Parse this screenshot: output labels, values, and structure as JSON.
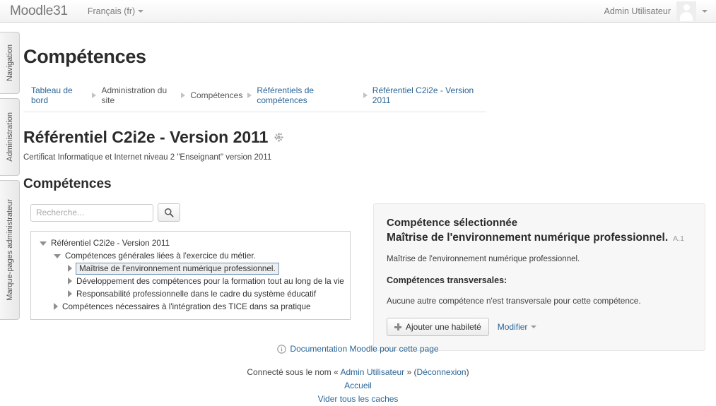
{
  "navbar": {
    "brand": "Moodle31",
    "language": "Français (fr)",
    "user_name": "Admin Utilisateur",
    "avatar_icon": "user-avatar-icon",
    "caret_icon": "chevron-down-icon"
  },
  "dock": {
    "tabs": [
      {
        "label": "Navigation"
      },
      {
        "label": "Administration"
      },
      {
        "label": "Marque-pages administrateur"
      }
    ]
  },
  "page": {
    "title": "Compétences"
  },
  "breadcrumb": {
    "items": [
      {
        "label": "Tableau de bord",
        "link": true
      },
      {
        "label": "Administration du site",
        "link": false
      },
      {
        "label": "Compétences",
        "link": false
      },
      {
        "label": "Référentiels de compétences",
        "link": true
      },
      {
        "label": "Référentiel C2i2e - Version 2011",
        "link": true
      }
    ]
  },
  "framework": {
    "title": "Référentiel C2i2e - Version 2011",
    "settings_icon": "gear-icon",
    "description": "Certificat Informatique et Internet niveau 2 \"Enseignant\" version 2011",
    "section_title": "Compétences"
  },
  "search": {
    "placeholder": "Recherche...",
    "value": "",
    "button_icon": "search-icon"
  },
  "tree": {
    "nodes": [
      {
        "label": "Référentiel C2i2e - Version 2011",
        "level": 0,
        "state": "expanded",
        "selected": false
      },
      {
        "label": "Compétences générales liées à l'exercice du métier.",
        "level": 1,
        "state": "expanded",
        "selected": false
      },
      {
        "label": "Maîtrise de l'environnement numérique professionnel.",
        "level": 2,
        "state": "collapsed",
        "selected": true
      },
      {
        "label": "Développement des compétences pour la formation tout au long de la vie",
        "level": 2,
        "state": "collapsed",
        "selected": false
      },
      {
        "label": "Responsabilité professionnelle dans le cadre du système éducatif",
        "level": 2,
        "state": "collapsed",
        "selected": false
      },
      {
        "label": "Compétences nécessaires à l'intégration des TICE dans sa pratique",
        "level": 1,
        "state": "collapsed",
        "selected": false
      }
    ]
  },
  "panel": {
    "kicker": "Compétence sélectionnée",
    "title": "Maîtrise de l'environnement numérique professionnel.",
    "idnumber": "A.1",
    "description": "Maîtrise de l'environnement numérique professionnel.",
    "subhead": "Compétences transversales:",
    "empty_text": "Aucune autre compétence n'est transversale pour cette compétence.",
    "add_button": "Ajouter une habileté",
    "add_button_icon": "plus-icon",
    "edit_menu": "Modifier",
    "edit_menu_icon": "chevron-down-icon"
  },
  "footer": {
    "doc_link": "Documentation Moodle pour cette page",
    "doc_icon": "info-icon",
    "login_prefix": "Connecté sous le nom «",
    "login_user": "Admin Utilisateur",
    "login_middle": "»",
    "logout_open": "(",
    "logout": "Déconnexion",
    "logout_close": ")",
    "home": "Accueil",
    "purge": "Vider tous les caches"
  },
  "colors": {
    "link": "#2a6496",
    "panel_bg": "#f7f7f7",
    "selected_border": "#6a92b5"
  }
}
